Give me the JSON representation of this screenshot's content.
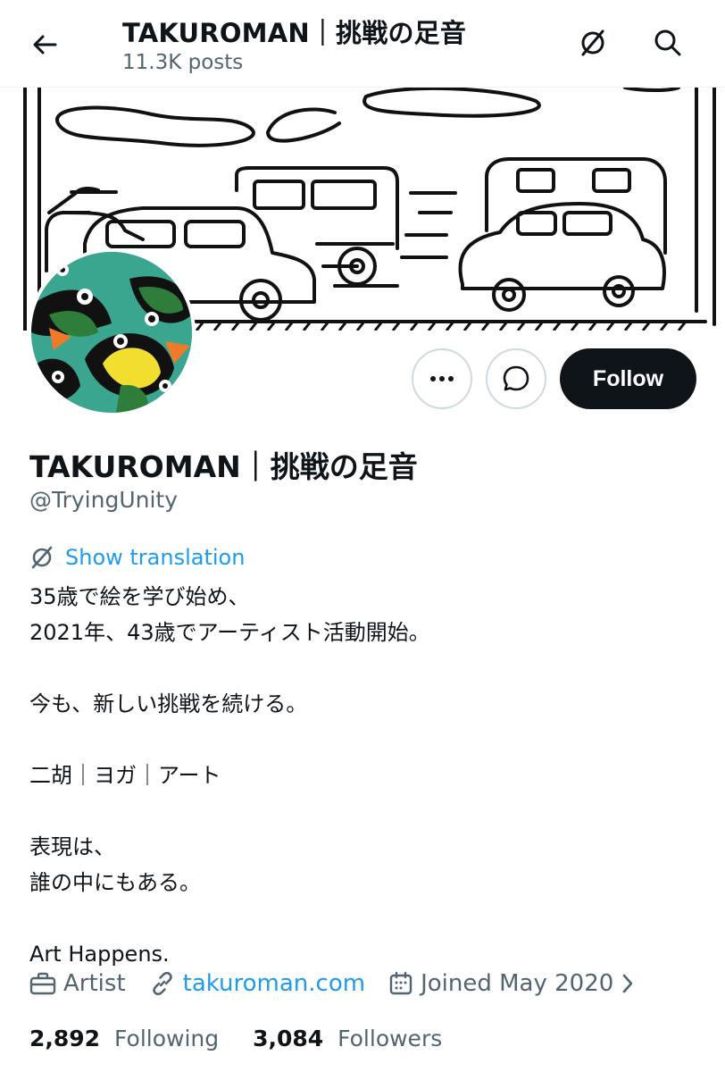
{
  "header": {
    "title": "TAKUROMAN｜挑戦の足音",
    "post_count": "11.3K posts",
    "icons": [
      "back-arrow-icon",
      "translate-icon",
      "search-icon"
    ]
  },
  "profile": {
    "display_name": "TAKUROMAN｜挑戦の足音",
    "handle": "@TryingUnity",
    "actions": {
      "more_icon": "more-icon",
      "message_icon": "message-icon",
      "follow_label": "Follow"
    },
    "show_translation": "Show translation",
    "bio_lines": [
      "35歳で絵を学び始め、",
      "2021年、43歳でアーティスト活動開始。",
      "",
      "今も、新しい挑戦を続ける。",
      "",
      "二胡｜ヨガ｜アート",
      "",
      "表現は、",
      "誰の中にもある。",
      "",
      "Art Happens."
    ],
    "meta": {
      "category": "Artist",
      "website": "takuroman.com",
      "joined": "Joined May 2020"
    },
    "stats": {
      "following_count": "2,892",
      "following_label": "Following",
      "followers_count": "3,084",
      "followers_label": "Followers"
    }
  },
  "colors": {
    "accent": "#1d9bf0",
    "text_primary": "#0f1419",
    "text_secondary": "#536471",
    "follow_bg": "#0f1419",
    "avatar_bg": "#3aa68f"
  }
}
